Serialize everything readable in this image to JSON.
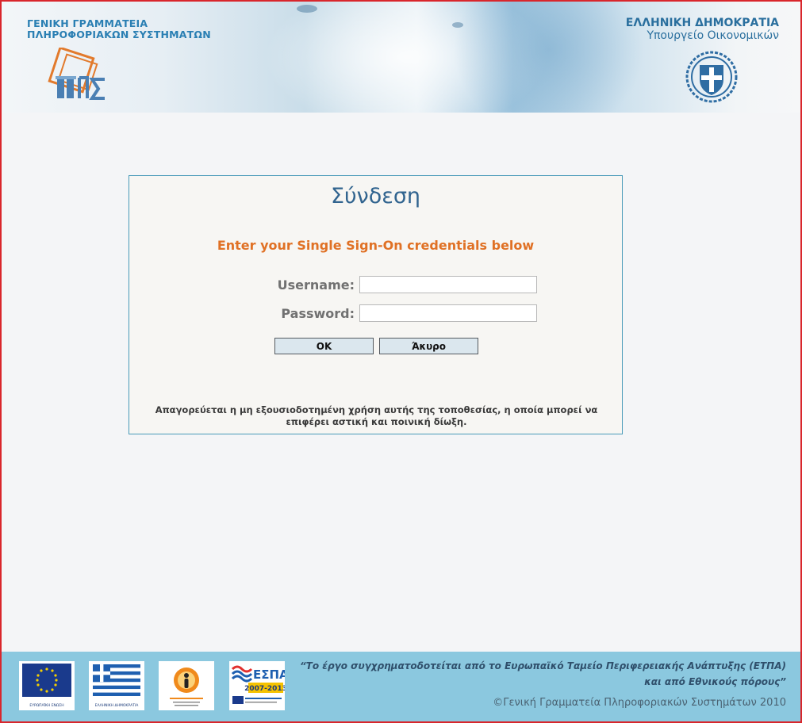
{
  "header": {
    "org_left_line1": "ΓΕΝΙΚΗ ΓΡΑΜΜΑΤΕΙΑ",
    "org_left_line2": "ΠΛΗΡΟΦΟΡΙΑΚΩΝ ΣΥΣΤΗΜΑΤΩΝ",
    "org_right_line1": "ΕΛΛΗΝΙΚΗ ΔΗΜΟΚΡΑΤΙΑ",
    "org_right_line2": "Υπουργείο Οικονομικών"
  },
  "login": {
    "title": "Σύνδεση",
    "subtitle": "Enter your Single Sign-On credentials below",
    "username_label": "Username:",
    "password_label": "Password:",
    "username_value": "",
    "password_value": "",
    "ok_label": "OK",
    "cancel_label": "Άκυρο",
    "warning_line1": "Απαγορεύεται η μη εξουσιοδοτημένη χρήση αυτής της τοποθεσίας, η οποία μπορεί να",
    "warning_line2": "επιφέρει αστική και ποινική δίωξη."
  },
  "footer": {
    "eu_caption": "ΕΥΡΩΠΑΪΚΗ ΕΝΩΣΗ",
    "gr_caption": "ΕΛΛΗΝΙΚΗ ΔΗΜΟΚΡΑΤΙΑ",
    "espa_text": "ΕΣΠΑ",
    "espa_years": "2007-2013",
    "quote_line1": "“Το έργο συγχρηματοδοτείται από το Ευρωπαϊκό Ταμείο Περιφερειακής Ανάπτυξης (ΕΤΠΑ)",
    "quote_line2": "και από Εθνικούς πόρους”",
    "copyright": "©Γενική Γραμματεία Πληροφοριακών Συστημάτων 2010"
  },
  "colors": {
    "frame_border": "#d9262c",
    "title": "#31648f",
    "subtitle": "#e07125",
    "footer_bg": "#8bc8df"
  },
  "icons": [
    "gsis-logo",
    "greek-emblem-icon",
    "eu-flag-icon",
    "greek-flag-icon",
    "digital-convergence-logo",
    "espa-logo"
  ]
}
